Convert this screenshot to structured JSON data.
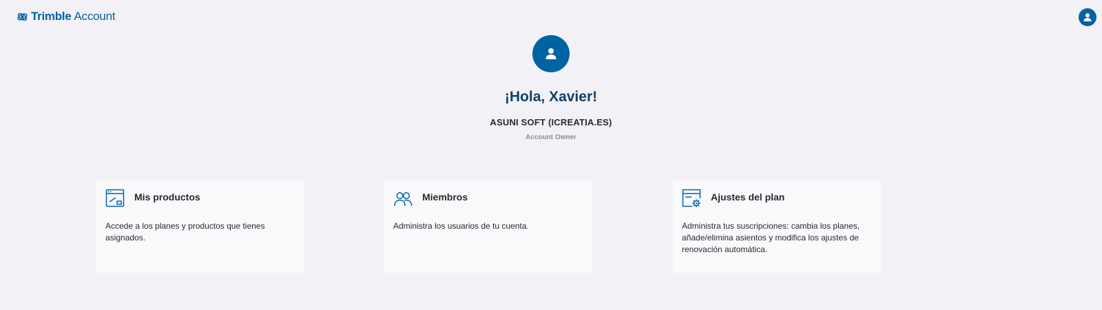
{
  "header": {
    "brand": "Trimble",
    "product": "Account",
    "logo_icon": "trimble-globe-icon",
    "user_icon": "user-avatar-icon"
  },
  "hero": {
    "greeting": "¡Hola, Xavier!",
    "company": "ASUNI SOFT (ICREATIA.ES)",
    "role": "Account Owner"
  },
  "cards": [
    {
      "title": "Mis productos",
      "description": "Accede a los planes y productos que tienes asignados.",
      "icon": "products-window-icon"
    },
    {
      "title": "Miembros",
      "description": "Administra los usuarios de tu cuenta.",
      "icon": "members-icon"
    },
    {
      "title": "Ajustes del plan",
      "description": "Administra tus suscripciones: cambia los planes, añade/elimina asientos y modifica los ajustes de renovación automática.",
      "icon": "plan-settings-icon"
    }
  ],
  "colors": {
    "primary": "#0063a3",
    "greeting": "#0e416c",
    "background": "#f2f2f6",
    "card": "#f9f9fb"
  }
}
